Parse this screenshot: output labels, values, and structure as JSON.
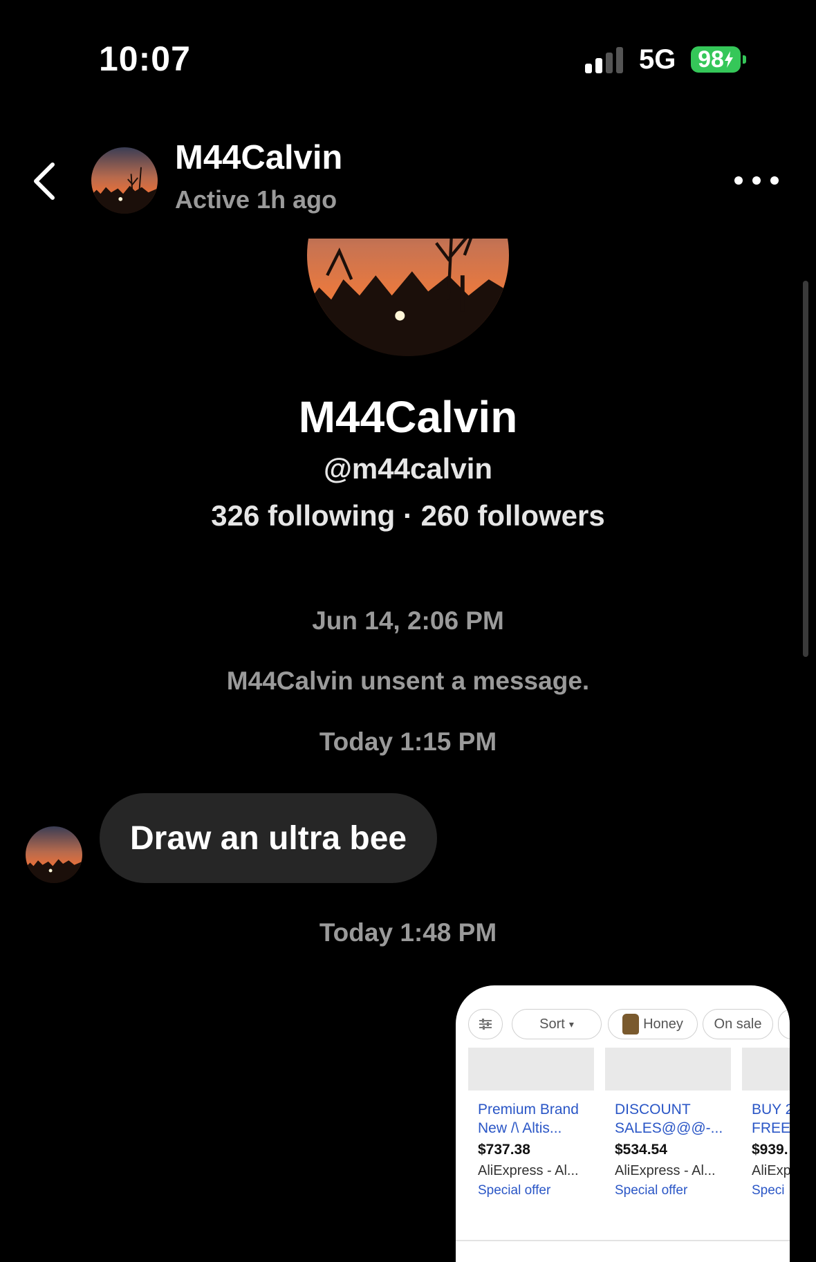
{
  "status_bar": {
    "time": "10:07",
    "network": "5G",
    "battery": "98"
  },
  "header": {
    "name": "M44Calvin",
    "status": "Active 1h ago",
    "back_icon": "chevron-left-icon",
    "more_icon": "ellipsis-icon"
  },
  "profile": {
    "name": "M44Calvin",
    "handle": "@m44calvin",
    "stats": "326 following · 260 followers"
  },
  "conversation": {
    "timestamp_1": "Jun 14, 2:06 PM",
    "system_message": "M44Calvin unsent a message.",
    "timestamp_2": "Today 1:15 PM",
    "message_1": "Draw an ultra bee",
    "timestamp_3": "Today 1:48 PM"
  },
  "shared_image": {
    "chips": {
      "sort": "Sort",
      "honey": "Honey",
      "on_sale": "On sale"
    },
    "products": [
      {
        "title_line1": "Premium Brand",
        "title_line2": "New /\\ Altis...",
        "price": "$737.38",
        "source": "AliExpress - Al...",
        "offer": "Special offer"
      },
      {
        "title_line1": "DISCOUNT",
        "title_line2": "SALES@@@-...",
        "price": "$534.54",
        "source": "AliExpress - Al...",
        "offer": "Special offer"
      },
      {
        "title_line1": "BUY 2",
        "title_line2": "FREE",
        "price": "$939.",
        "source": "AliExp",
        "offer": "Speci"
      }
    ]
  },
  "colors": {
    "background": "#000000",
    "bubble": "#262626",
    "muted_text": "#9a9a9a",
    "battery": "#35c759",
    "link_blue": "#2a56c6"
  }
}
